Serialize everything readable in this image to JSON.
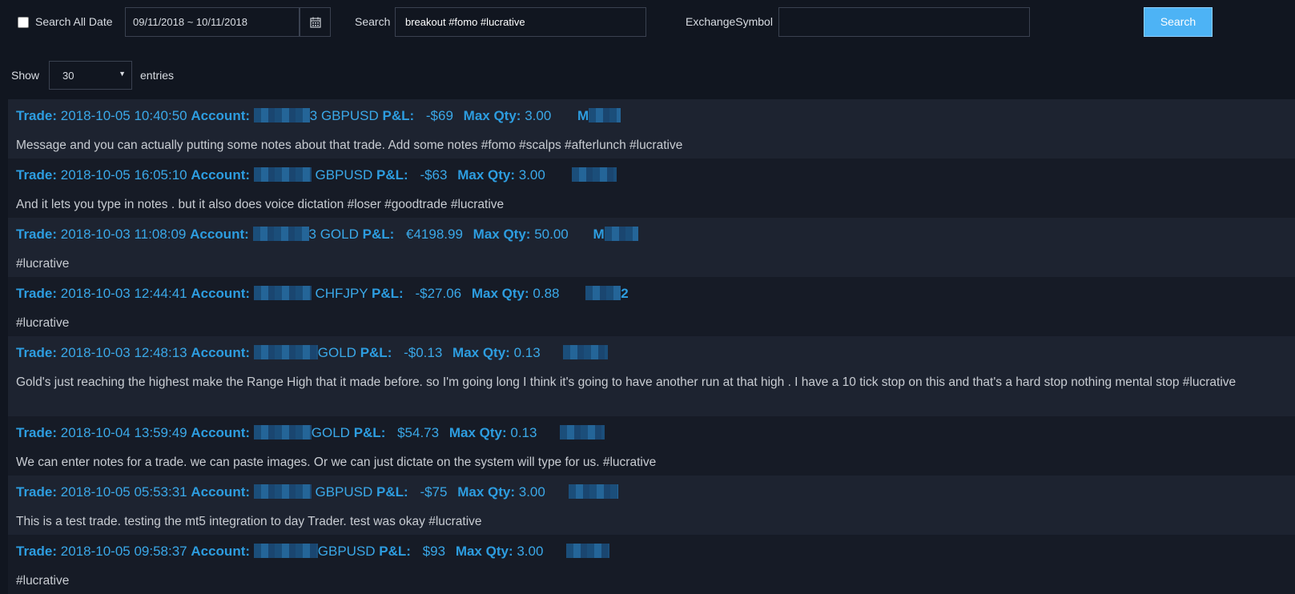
{
  "filters": {
    "search_all_date_label": "Search All Date",
    "date_range": "09/11/2018 ~ 10/11/2018",
    "search_label": "Search",
    "search_value": "breakout #fomo #lucrative",
    "exchange_label": "ExchangeSymbol",
    "exchange_value": "",
    "search_button": "Search"
  },
  "paging": {
    "show_label": "Show",
    "entries_value": "30",
    "entries_label": "entries"
  },
  "labels": {
    "trade": "Trade:",
    "account": "Account:",
    "pnl": "P&L:",
    "maxqty": "Max Qty:"
  },
  "entries": [
    {
      "datetime": "2018-10-05 10:40:50",
      "account_suffix": "3 GBPUSD",
      "pnl": "-$69",
      "maxqty": "3.00",
      "tag_prefix": "M",
      "note": "Message and you can actually putting some notes about that trade. Add some notes #fomo #scalps #afterlunch #lucrative"
    },
    {
      "datetime": "2018-10-05 16:05:10",
      "account_suffix": "GBPUSD",
      "pnl": "-$63",
      "maxqty": "3.00",
      "tag_prefix": "",
      "note": "And it lets you type in notes . but it also does voice dictation #loser #goodtrade #lucrative"
    },
    {
      "datetime": "2018-10-03 11:08:09",
      "account_suffix": "3 GOLD",
      "pnl": "€4198.99",
      "maxqty": "50.00",
      "tag_prefix": "M",
      "note": "#lucrative"
    },
    {
      "datetime": "2018-10-03 12:44:41",
      "account_suffix": "CHFJPY",
      "pnl": "-$27.06",
      "maxqty": "0.88",
      "tag_prefix": "2",
      "note": "#lucrative"
    },
    {
      "datetime": "2018-10-03 12:48:13",
      "account_suffix": "GOLD",
      "pnl": "-$0.13",
      "maxqty": "0.13",
      "tag_prefix": "",
      "note": "Gold's just reaching the highest make the Range High that it made before. so I'm going long I think it's going to have another run at that high . I have a 10 tick stop on this and that's a hard stop nothing mental stop #lucrative"
    },
    {
      "datetime": "2018-10-04 13:59:49",
      "account_suffix": "GOLD",
      "pnl": "$54.73",
      "maxqty": "0.13",
      "tag_prefix": "",
      "note": "We can enter notes for a trade. we can paste images. Or we can just dictate on the system will type for us. #lucrative"
    },
    {
      "datetime": "2018-10-05 05:53:31",
      "account_suffix": "GBPUSD",
      "pnl": "-$75",
      "maxqty": "3.00",
      "tag_prefix": "",
      "note": "This is a test trade. testing the mt5 integration to day Trader. test was okay #lucrative"
    },
    {
      "datetime": "2018-10-05 09:58:37",
      "account_suffix": "GBPUSD",
      "pnl": "$93",
      "maxqty": "3.00",
      "tag_prefix": "",
      "note": "#lucrative"
    }
  ]
}
